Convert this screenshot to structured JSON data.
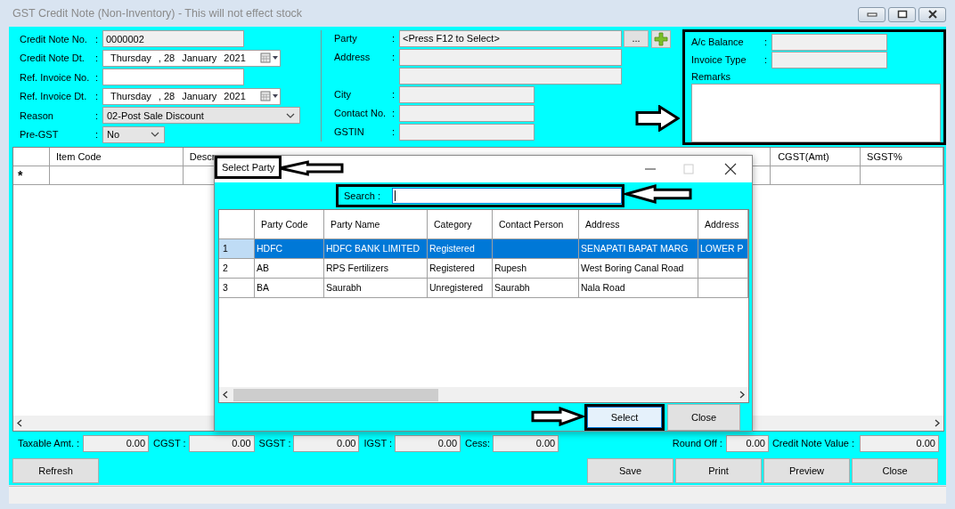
{
  "window": {
    "title": "GST Credit Note (Non-Inventory) - This will not effect stock"
  },
  "left_fields": [
    {
      "label": "Credit Note No.",
      "separator": ":",
      "kind": "text",
      "readonly": true,
      "value": "0000002"
    },
    {
      "label": "Credit Note Dt.",
      "separator": ":",
      "kind": "date",
      "parts": [
        "Thursday",
        ", 28",
        "January",
        "2021"
      ]
    },
    {
      "label": "Ref. Invoice No.",
      "separator": ":",
      "kind": "text",
      "readonly": false
    },
    {
      "label": "Ref. Invoice Dt.",
      "separator": ":",
      "kind": "date",
      "parts": [
        "Thursday",
        ", 28",
        "January",
        "2021"
      ]
    },
    {
      "label": "Reason",
      "separator": ":",
      "kind": "combo",
      "value": "02-Post Sale Discount"
    },
    {
      "label": "Pre-GST",
      "separator": ":",
      "kind": "combo_small",
      "value": "No"
    }
  ],
  "party_fields": [
    {
      "label": "Party",
      "separator": ":",
      "kind": "party",
      "value": "<Press F12 to Select>"
    },
    {
      "label": "Address",
      "separator": ":",
      "kind": "wide"
    },
    {
      "kind": "wide"
    },
    {
      "label": "City",
      "separator": ":",
      "kind": "short"
    },
    {
      "label": "Contact No.",
      "separator": ":",
      "kind": "short"
    },
    {
      "label": "GSTIN",
      "separator": ":",
      "kind": "short"
    }
  ],
  "party_browse_button": "...",
  "summary_panel": {
    "fields": [
      {
        "label": "A/c Balance",
        "separator": ":"
      },
      {
        "label": "Invoice Type",
        "separator": ":"
      }
    ],
    "remarks_label": "Remarks"
  },
  "grid": {
    "columns": [
      "Item Code",
      "Descr",
      "CGST(Amt)",
      "SGST%"
    ],
    "new_row_marker": "*"
  },
  "totals": [
    {
      "label": "Taxable Amt. :",
      "value": "0.00"
    },
    {
      "label": "CGST :",
      "value": "0.00"
    },
    {
      "label": "SGST :",
      "value": "0.00"
    },
    {
      "label": "IGST :",
      "value": "0.00"
    },
    {
      "label": "Cess:",
      "value": "0.00"
    }
  ],
  "round_off": {
    "label": "Round Off :",
    "value": "0.00"
  },
  "credit_note_value": {
    "label": "Credit Note Value :",
    "value": "0.00"
  },
  "left_buttons": [
    "Refresh"
  ],
  "right_buttons": [
    "Save",
    "Print",
    "Preview",
    "Close"
  ],
  "dialog": {
    "title": "Select Party",
    "search_label": "Search :",
    "columns": [
      "Party Code",
      "Party Name",
      "Category",
      "Contact Person",
      "Address",
      "Address"
    ],
    "rows": [
      {
        "number": "1",
        "selected": true,
        "cells": [
          "HDFC",
          "HDFC BANK LIMITED",
          "Registered",
          "",
          "SENAPATI BAPAT MARG",
          "LOWER P"
        ]
      },
      {
        "number": "2",
        "selected": false,
        "cells": [
          "AB",
          "RPS Fertilizers",
          "Registered",
          "Rupesh",
          "West Boring Canal Road",
          ""
        ]
      },
      {
        "number": "3",
        "selected": false,
        "cells": [
          "BA",
          "Saurabh",
          "Unregistered",
          "Saurabh",
          "Nala Road",
          ""
        ]
      }
    ],
    "buttons": [
      {
        "label": "Select",
        "selected": true
      },
      {
        "label": "Close",
        "selected": false
      }
    ]
  }
}
